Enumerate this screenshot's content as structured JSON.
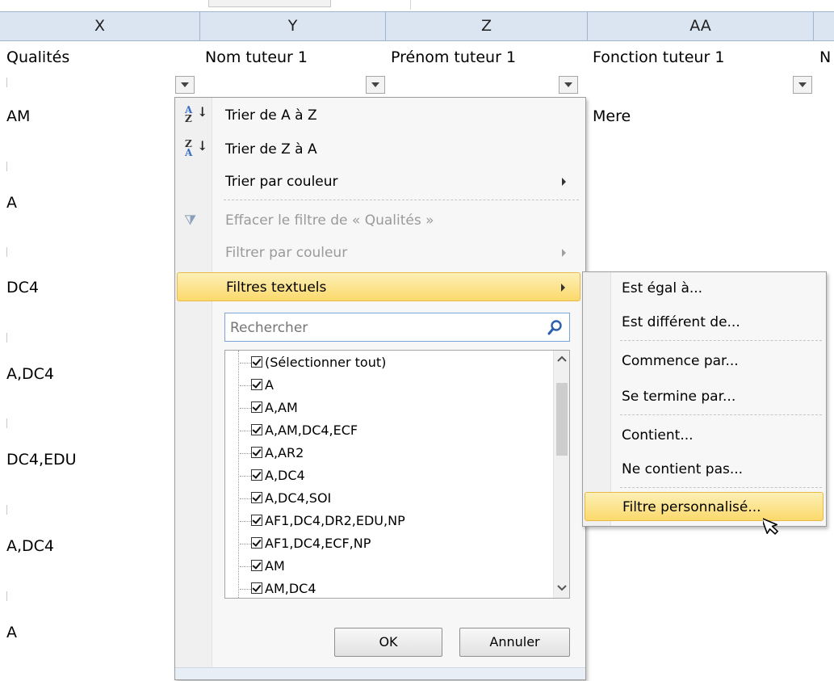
{
  "columns": [
    {
      "letter": "X"
    },
    {
      "letter": "Y"
    },
    {
      "letter": "Z"
    },
    {
      "letter": "AA"
    }
  ],
  "row_headers": [
    "Qualités",
    "Nom tuteur 1",
    "Prénom tuteur 1",
    "Fonction tuteur 1",
    "N"
  ],
  "cells_x": [
    "AM",
    "A",
    "DC4",
    "A,DC4",
    "DC4,EDU",
    "A,DC4",
    "A"
  ],
  "cell_aa_first": "Mere",
  "menu": {
    "sort_az": "Trier de A à Z",
    "sort_za": "Trier de Z à A",
    "sort_color": "Trier par couleur",
    "clear_filter": "Effacer le filtre de « Qualités »",
    "filter_color": "Filtrer par couleur",
    "text_filters": "Filtres textuels",
    "search_placeholder": "Rechercher",
    "items": [
      "(Sélectionner tout)",
      "A",
      "A,AM",
      "A,AM,DC4,ECF",
      "A,AR2",
      "A,DC4",
      "A,DC4,SOI",
      "AF1,DC4,DR2,EDU,NP",
      "AF1,DC4,ECF,NP",
      "AM",
      "AM,DC4"
    ],
    "ok": "OK",
    "cancel": "Annuler"
  },
  "submenu": {
    "equals": "Est égal à...",
    "not_equals": "Est différent de...",
    "begins_with": "Commence par...",
    "ends_with": "Se termine par...",
    "contains": "Contient...",
    "not_contains": "Ne contient pas...",
    "custom": "Filtre personnalisé..."
  }
}
